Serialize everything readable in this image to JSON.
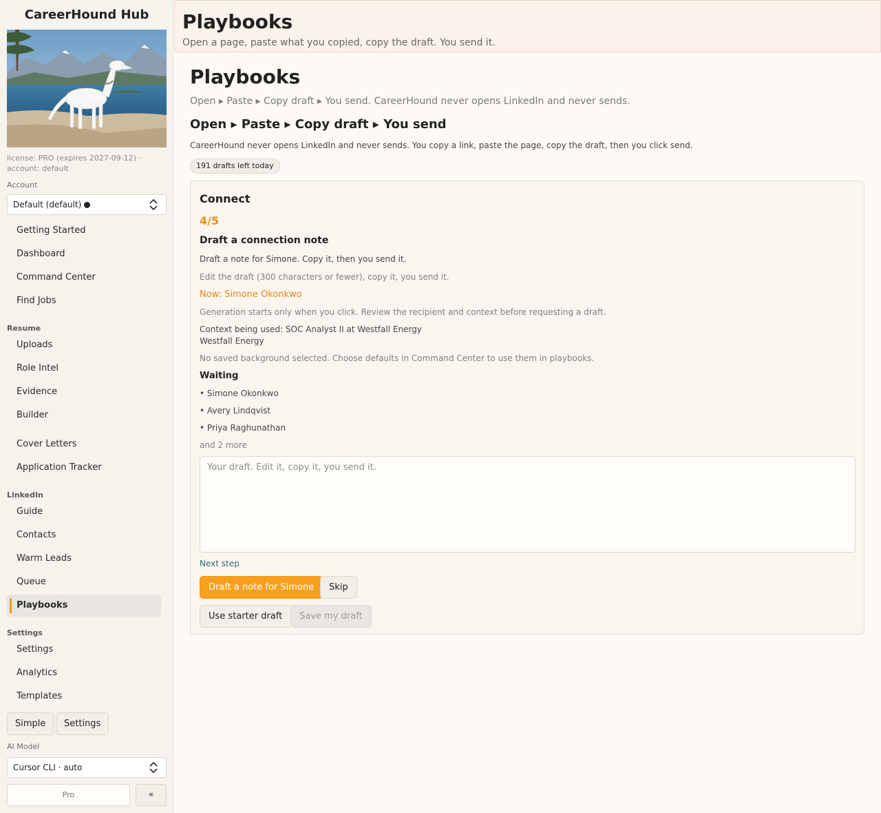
{
  "sidebar": {
    "app_title": "CareerHound Hub",
    "license": "license: PRO (expires 2027-09-12) · account: default",
    "account_label": "Account",
    "account_value": "Default (default)",
    "groups": {
      "resume": "Resume",
      "linkedin": "LinkedIn",
      "settings": "Settings"
    },
    "items": {
      "getting_started": "Getting Started",
      "dashboard": "Dashboard",
      "command_center": "Command Center",
      "find_jobs": "Find Jobs",
      "uploads": "Uploads",
      "role_intel": "Role Intel",
      "evidence": "Evidence",
      "builder": "Builder",
      "cover_letters": "Cover Letters",
      "application_tracker": "Application Tracker",
      "guide": "Guide",
      "contacts": "Contacts",
      "warm_leads": "Warm Leads",
      "queue": "Queue",
      "playbooks": "Playbooks",
      "settings": "Settings",
      "analytics": "Analytics",
      "templates": "Templates"
    },
    "mode_buttons": {
      "simple": "Simple",
      "settings": "Settings"
    },
    "ai_model_label": "AI Model",
    "ai_model_value": "Cursor CLI · auto",
    "pro_label": "Pro",
    "collapse_label": "«"
  },
  "header": {
    "title": "Playbooks",
    "subtitle": "Open a page, paste what you copied, copy the draft. You send it."
  },
  "main": {
    "title": "Playbooks",
    "subtitle": "Open ▸ Paste ▸ Copy draft ▸ You send. CareerHound never opens LinkedIn and never sends.",
    "heading": "Open ▸ Paste ▸ Copy draft ▸ You send",
    "description": "CareerHound never opens LinkedIn and never sends. You copy a link, paste the page, copy the draft, then you click send.",
    "drafts_left": "191 drafts left today"
  },
  "card": {
    "title": "Connect",
    "step": "4/5",
    "step_title": "Draft a connection note",
    "instruction": "Draft a note for Simone. Copy it, then you send it.",
    "edit_hint": "Edit the draft (300 characters or fewer), copy it, you send it.",
    "now": "Now: Simone Okonkwo",
    "generation_note": "Generation starts only when you click. Review the recipient and context before requesting a draft.",
    "context_line1": "Context being used: SOC Analyst II at Westfall Energy",
    "context_line2": "Westfall Energy",
    "background_note": "No saved background selected. Choose defaults in Command Center to use them in playbooks.",
    "waiting_label": "Waiting",
    "waiting": [
      "• Simone Okonkwo",
      "• Avery Lindqvist",
      "• Priya Raghunathan"
    ],
    "more": "and 2 more",
    "draft_placeholder": "Your draft. Edit it, copy it, you send it.",
    "next_step": "Next step",
    "buttons": {
      "draft": "Draft a note for Simone",
      "skip": "Skip",
      "starter": "Use starter draft",
      "save": "Save my draft"
    }
  },
  "colors": {
    "accent": "#f7a01c",
    "step": "#e0941f",
    "link": "#2f6a7d"
  }
}
